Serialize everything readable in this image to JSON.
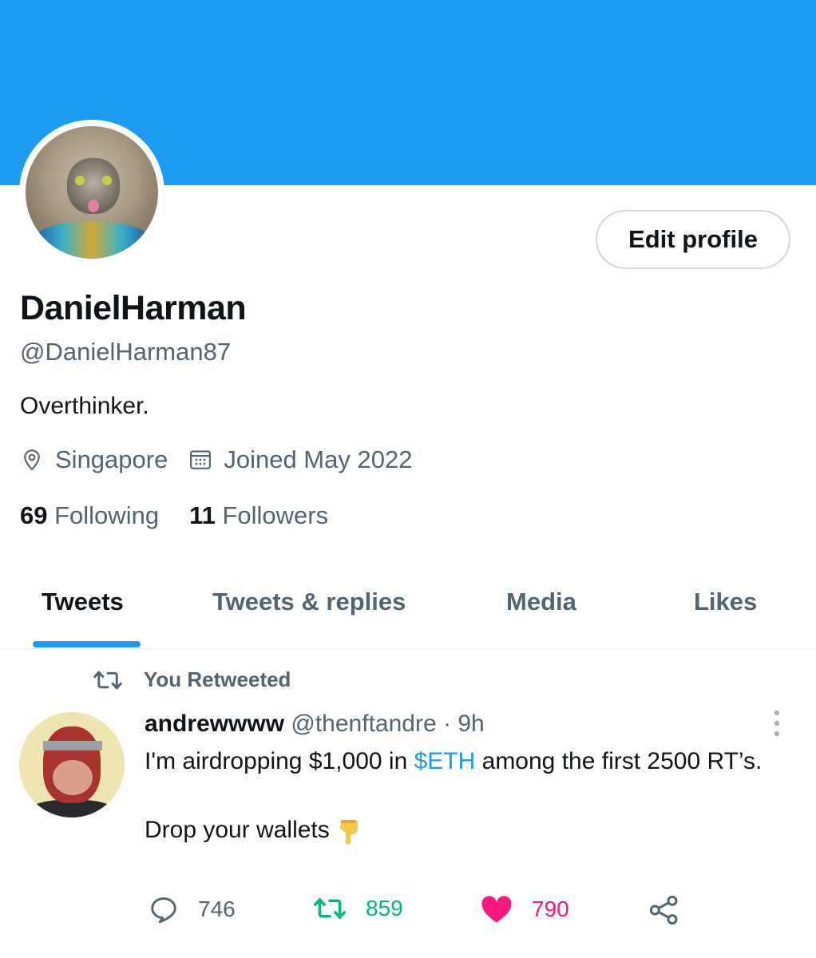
{
  "profile": {
    "edit_label": "Edit profile",
    "name": "DanielHarman",
    "handle": "@DanielHarman87",
    "bio": "Overthinker.",
    "location": "Singapore",
    "joined": "Joined May 2022",
    "following_count": "69",
    "following_label": "Following",
    "followers_count": "11",
    "followers_label": "Followers"
  },
  "tabs": [
    {
      "label": "Tweets",
      "active": true
    },
    {
      "label": "Tweets & replies",
      "active": false
    },
    {
      "label": "Media",
      "active": false
    },
    {
      "label": "Likes",
      "active": false
    }
  ],
  "tweet": {
    "retweet_context": "You Retweeted",
    "author_name": "andrewwww",
    "author_handle": "@thenftandre",
    "separator": "·",
    "time": "9h",
    "text_before": "I'm airdropping $1,000 in ",
    "cashtag": "$ETH",
    "text_after": " among the first 2500 RT’s.",
    "text_line2": "Drop your wallets",
    "replies": "746",
    "retweets": "859",
    "likes": "790"
  },
  "colors": {
    "accent": "#1d9bf0",
    "retweet_green": "#00ba7c",
    "like_pink": "#f91880",
    "secondary_text": "#536471"
  },
  "icons": [
    "location-icon",
    "calendar-icon",
    "retweet-icon",
    "more-icon",
    "pointing-down-emoji",
    "reply-icon",
    "like-icon",
    "share-icon"
  ]
}
